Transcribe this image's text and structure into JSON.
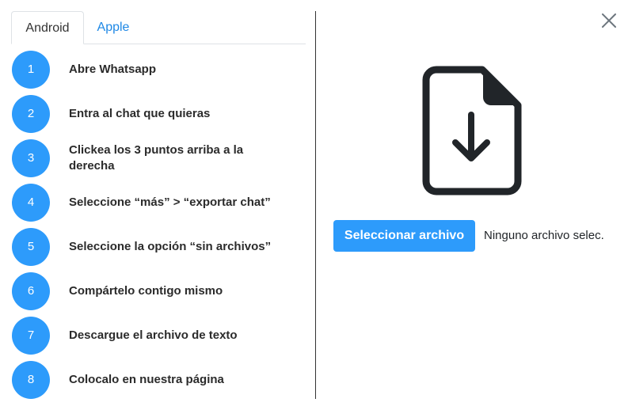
{
  "tabs": [
    {
      "label": "Android",
      "active": true
    },
    {
      "label": "Apple",
      "active": false
    }
  ],
  "steps": [
    {
      "number": "1",
      "text": "Abre Whatsapp"
    },
    {
      "number": "2",
      "text": "Entra al chat que quieras"
    },
    {
      "number": "3",
      "text": "Clickea los 3 puntos arriba a la derecha"
    },
    {
      "number": "4",
      "text": "Seleccione “más” > “exportar chat”"
    },
    {
      "number": "5",
      "text": "Seleccione la opción “sin archivos”"
    },
    {
      "number": "6",
      "text": "Compártelo contigo mismo"
    },
    {
      "number": "7",
      "text": "Descargue el archivo de texto"
    },
    {
      "number": "8",
      "text": "Colocalo en nuestra página"
    }
  ],
  "upload": {
    "icon": "file-download-icon",
    "button_label": "Seleccionar archivo",
    "status_text": "Ninguno archivo selec."
  },
  "close_icon": "close-icon",
  "colors": {
    "accent": "#2d9bfb",
    "tab_link": "#1e88e5",
    "icon": "#212529"
  }
}
